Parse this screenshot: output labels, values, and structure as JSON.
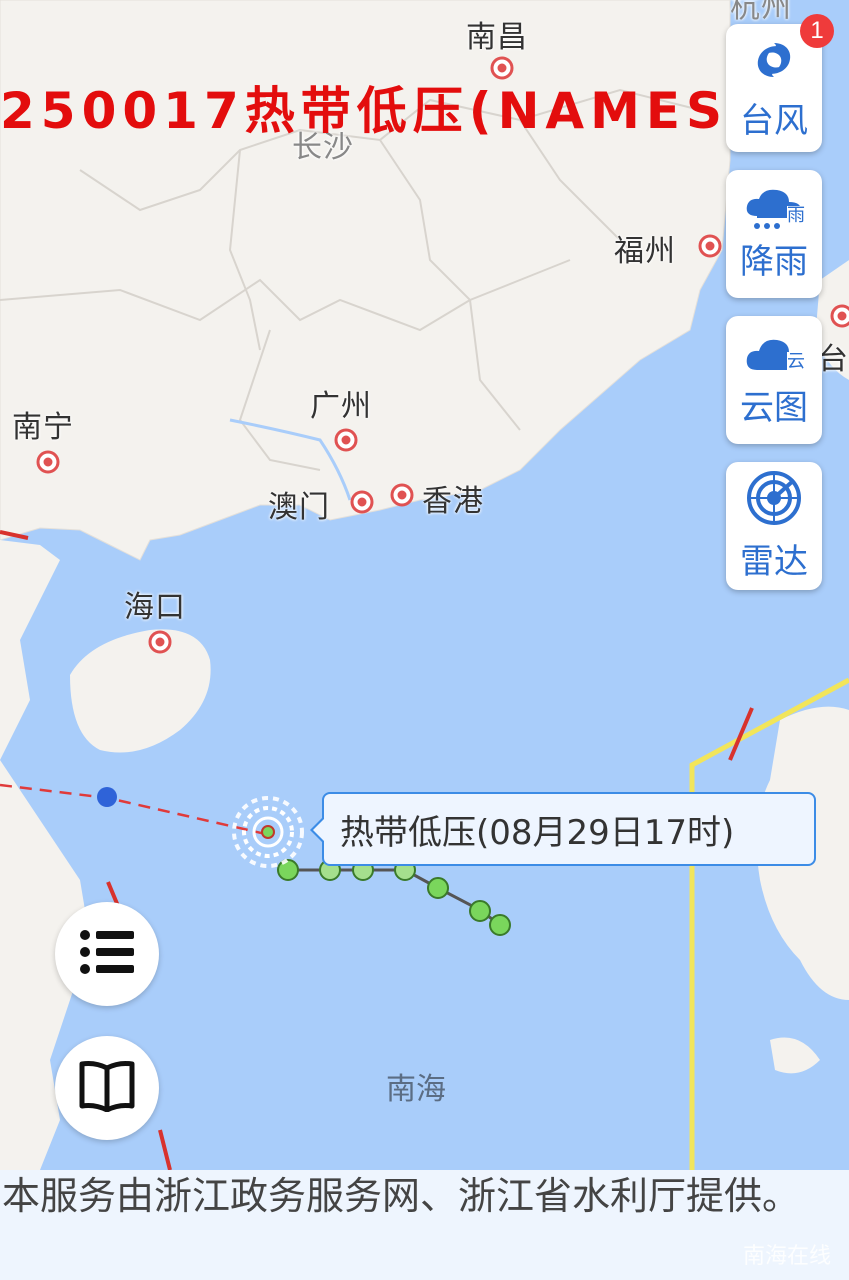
{
  "banner": {
    "title": "250017热带低压(NAMES"
  },
  "cities": [
    {
      "name": "南昌"
    },
    {
      "name": "长沙"
    },
    {
      "name": "福州"
    },
    {
      "name": "南宁"
    },
    {
      "name": "广州"
    },
    {
      "name": "澳门"
    },
    {
      "name": "香港"
    },
    {
      "name": "海口"
    },
    {
      "name": "杭州"
    },
    {
      "name": "台"
    }
  ],
  "sea": {
    "label": "南海"
  },
  "side_panel": {
    "typhoon": {
      "label": "台风",
      "badge": "1",
      "icon": "typhoon-icon"
    },
    "rain": {
      "label": "降雨",
      "icon": "rain-cloud-icon",
      "icon_text": "雨"
    },
    "cloud": {
      "label": "云图",
      "icon": "cloud-icon",
      "icon_text": "云"
    },
    "radar": {
      "label": "雷达",
      "icon": "radar-icon"
    }
  },
  "storm": {
    "tooltip": "热带低压(08月29日17时)"
  },
  "left_buttons": {
    "list": "list-icon",
    "legend": "book-icon"
  },
  "footer": {
    "text": "本服务由浙江政务服务网、浙江省水利厅提供。"
  },
  "watermark": "南海在线",
  "colors": {
    "accent": "#2d6fcf",
    "banner": "#e30d0d",
    "sea": "#a9cdfa",
    "land": "#f4f2ee",
    "track_point": "#7ad65c",
    "forecast_line": "#e03a3a",
    "warning_line": "#f2e55a"
  }
}
